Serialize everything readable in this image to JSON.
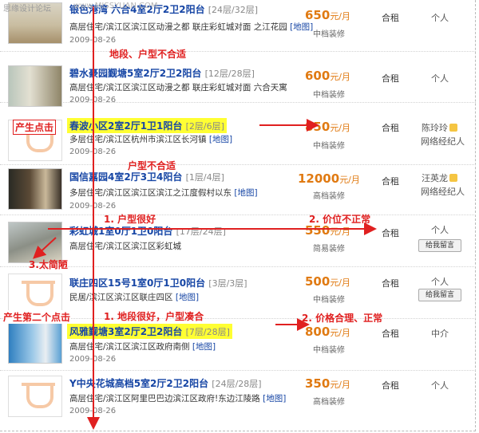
{
  "watermark": {
    "left": "思缘设计论坛",
    "right": "www.MISSYUAN.COM"
  },
  "listings": [
    {
      "title": "银色港湾 六合4室2厅2卫2阳台",
      "floor": "[24层/32层]",
      "loc": "高层住宅/滨江区滨江区动漫之都 联庄彩虹城对面 之江花园",
      "map": "[地图]",
      "date": "2009-08-26",
      "price": "650",
      "unit": "元/月",
      "deco": "中档装修",
      "rent": "合租",
      "who": "个人",
      "who2": ""
    },
    {
      "title": "碧水豪园觐塘5室2厅2卫2阳台",
      "floor": "[12层/28层]",
      "loc": "高层住宅/滨江区滨江区动漫之都 联庄彩虹城对面 六合天寓",
      "map": "[地图]",
      "date": "2009-08-26",
      "price": "600",
      "unit": "元/月",
      "deco": "中档装修",
      "rent": "合租",
      "who": "个人",
      "who2": ""
    },
    {
      "title": "春波小区2室2厅1卫1阳台",
      "floor": "[2层/6层]",
      "loc": "多层住宅/滨江区杭州市滨江区长河镇",
      "map": "[地图]",
      "date": "2009-08-26",
      "price": "850",
      "unit": "元/月",
      "deco": "中档装修",
      "rent": "合租",
      "who": "陈玲玲",
      "who2": "网络经纪人"
    },
    {
      "title": "国信嘉园4室2厅3卫4阳台",
      "floor": "[1层/4层]",
      "loc": "多层住宅/滨江区滨江区滨江之江度假村以东",
      "map": "[地图]",
      "date": "2009-08-26",
      "price": "12000",
      "unit": "元/月",
      "deco": "高档装修",
      "rent": "合租",
      "who": "汪英龙",
      "who2": "网络经纪人"
    },
    {
      "title": "彩虹城1室0厅1卫0阳台",
      "floor": "[17层/24层]",
      "loc": "高层住宅/滨江区滨江区彩虹城",
      "map": "[地图]",
      "date": "2009-08-26",
      "price": "550",
      "unit": "元/月",
      "deco": "简易装修",
      "rent": "合租",
      "who": "个人",
      "who2": "给我留言"
    },
    {
      "title": "联庄四区15号1室0厅1卫0阳台",
      "floor": "[3层/3层]",
      "loc": "民居/滨江区滨江区联庄四区",
      "map": "[地图]",
      "date": "2009-08-26",
      "price": "500",
      "unit": "元/月",
      "deco": "中档装修",
      "rent": "合租",
      "who": "个人",
      "who2": "给我留言"
    },
    {
      "title": "风雅觐塘3室2厅2卫2阳台",
      "floor": "[7层/28层]",
      "loc": "高层住宅/滨江区滨江区政府南侧",
      "map": "[地图]",
      "date": "2009-08-26",
      "price": "800",
      "unit": "元/月",
      "deco": "中档装修",
      "rent": "合租",
      "who": "中介",
      "who2": ""
    },
    {
      "title": "Y中央花城高档5室2厅2卫2阳台",
      "floor": "[24层/28层]",
      "loc": "高层住宅/滨江区阿里巴巴边滨江区政府!东边江陵路",
      "map": "[地图]",
      "date": "2009-08-26",
      "price": "350",
      "unit": "元/月",
      "deco": "高档装修",
      "rent": "合租",
      "who": "个人",
      "who2": ""
    }
  ],
  "annotations": {
    "a1": "地段、户型不合适",
    "a2": "产生点击",
    "a3": "户型不合适",
    "a4": "1. 户型很好",
    "a5": "2. 价位不正常",
    "a6": "3.太简陋",
    "a7": "产生第二个点击",
    "a8": "1. 地段很好，户型凑合",
    "a9": "2. 价格合理、正常"
  },
  "colors": {
    "accent": "#e02020",
    "highlight": "#ffff33",
    "link": "#1746a5",
    "price": "#e07a12"
  }
}
